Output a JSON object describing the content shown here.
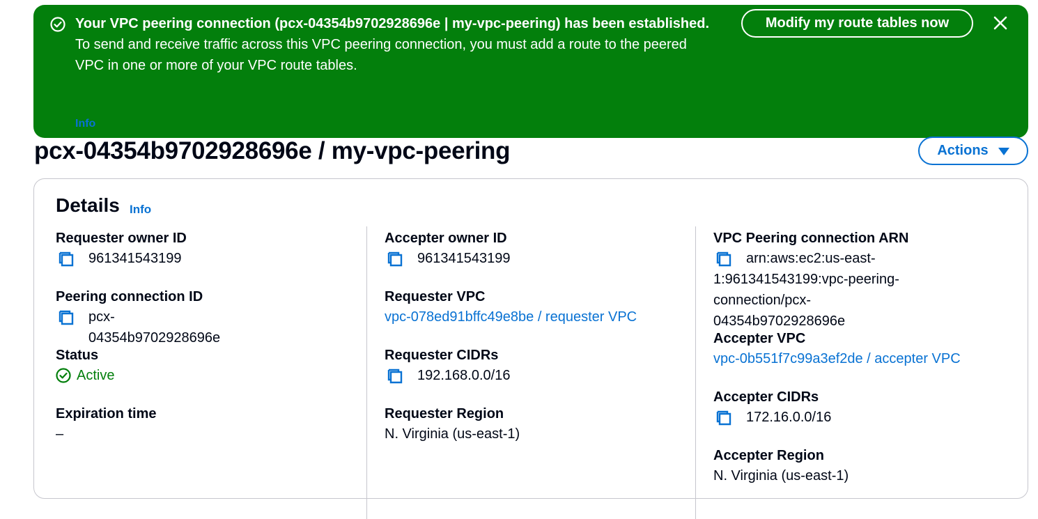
{
  "flash": {
    "title": "Your VPC peering connection (pcx-04354b9702928696e | my-vpc-peering) has been established.",
    "body": "To send and receive traffic across this VPC peering connection, you must add a route to the peered VPC in one or more of your VPC route tables.",
    "info_link": "Info",
    "modify_button": "Modify my route tables now",
    "close_icon": "close-icon",
    "status_icon": "check-circle-icon"
  },
  "header": {
    "title": "pcx-04354b9702928696e / my-vpc-peering",
    "actions_button": "Actions"
  },
  "details": {
    "title": "Details",
    "info_link": "Info",
    "col1": {
      "requester_owner_label": "Requester owner ID",
      "requester_owner_value": "961341543199",
      "peering_id_label": "Peering connection ID",
      "peering_id_value": "pcx-04354b9702928696e",
      "status_label": "Status",
      "status_value": "Active",
      "expiration_label": "Expiration time",
      "expiration_value": "–"
    },
    "col2": {
      "accepter_owner_label": "Accepter owner ID",
      "accepter_owner_value": "961341543199",
      "requester_vpc_label": "Requester VPC",
      "requester_vpc_value": "vpc-078ed91bffc49e8be / requester VPC",
      "requester_cidrs_label": "Requester CIDRs",
      "requester_cidrs_value": "192.168.0.0/16",
      "requester_region_label": "Requester Region",
      "requester_region_value": "N. Virginia (us-east-1)"
    },
    "col3": {
      "arn_label": "VPC Peering connection ARN",
      "arn_line1": "arn:aws:ec2:us-east-",
      "arn_line2": "1:961341543199:vpc-peering-",
      "arn_line3": "connection/pcx-04354b9702928696e",
      "accepter_vpc_label": "Accepter VPC",
      "accepter_vpc_value": "vpc-0b551f7c99a3ef2de / accepter VPC",
      "accepter_cidrs_label": "Accepter CIDRs",
      "accepter_cidrs_value": "172.16.0.0/16",
      "accepter_region_label": "Accepter Region",
      "accepter_region_value": "N. Virginia (us-east-1)"
    }
  },
  "colors": {
    "success": "#037f0c",
    "link": "#0972d3",
    "text": "#000716",
    "border": "#c6c6cd"
  }
}
